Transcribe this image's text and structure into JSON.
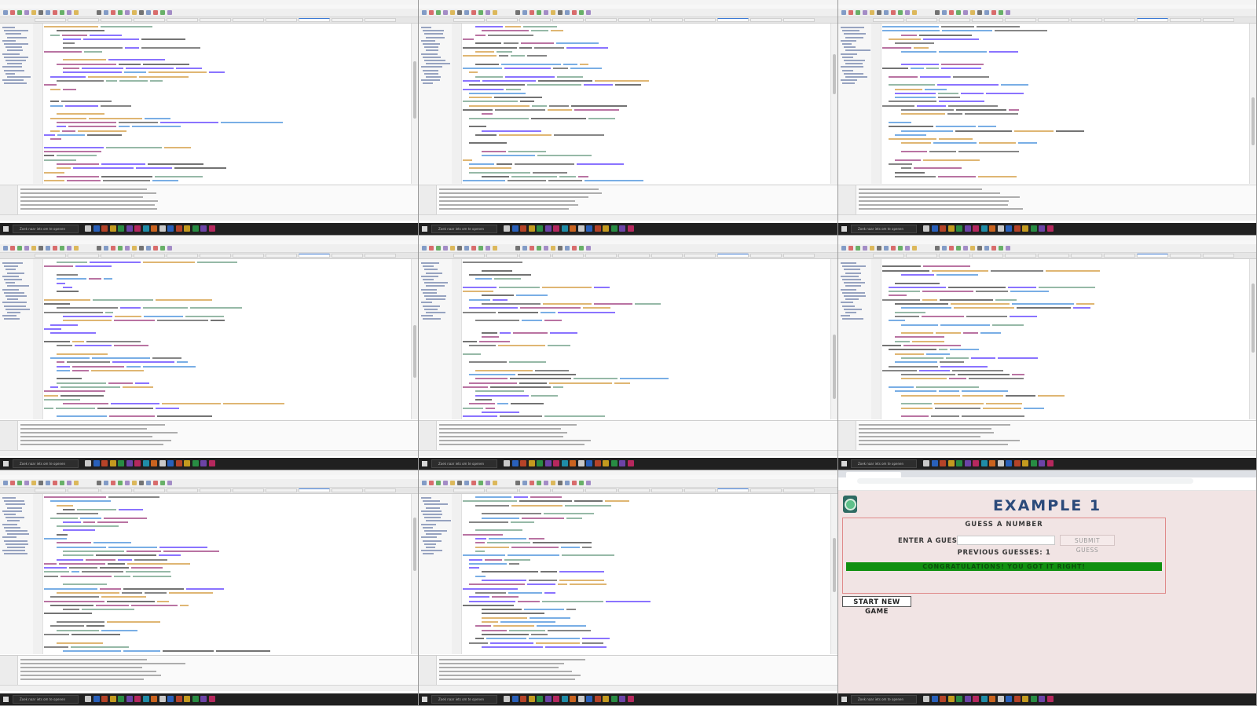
{
  "editor_panes_count": 8,
  "taskbar": {
    "search_placeholder": "Zoek naar iets om te openen"
  },
  "colors": {
    "page_bg": "#f1e4e4",
    "heading": "#2b4a7a",
    "result_bg": "#109010",
    "form_border": "#e08a8a"
  },
  "browser": {
    "page": {
      "heading": "EXAMPLE 1",
      "subheading": "GUESS A NUMBER",
      "guess_label": "ENTER A GUESS:",
      "guess_value": "",
      "submit_label": "SUBMIT GUESS",
      "previous_guesses": "PREVIOUS GUESSES: 1",
      "result": "CONGRATULATIONS! YOU GOT IT RIGHT!",
      "new_game_label": "START NEW GAME"
    }
  }
}
